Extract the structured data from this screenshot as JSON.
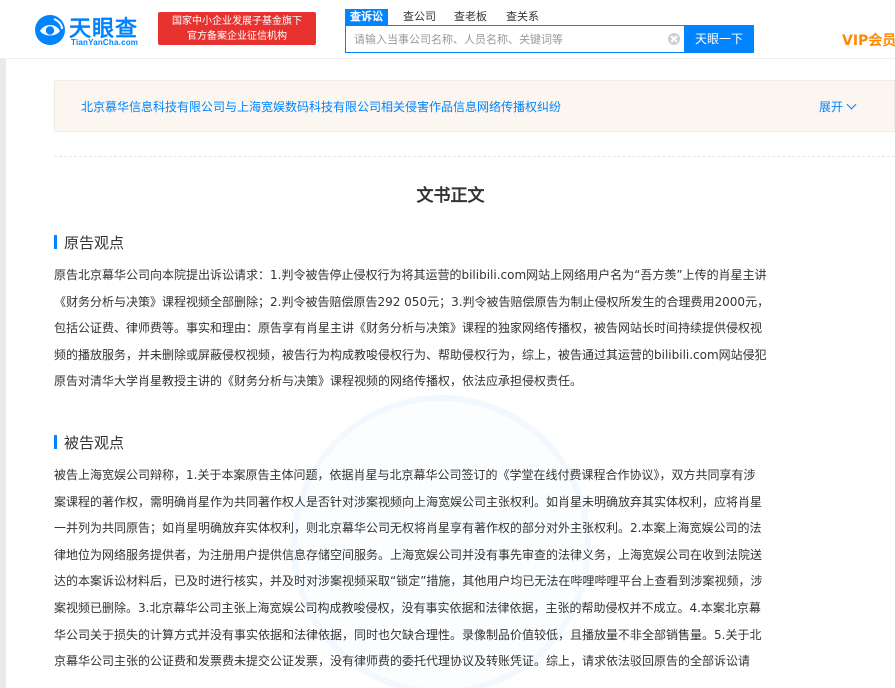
{
  "header": {
    "logo_title": "天眼查",
    "logo_sub": "TianYanCha.com",
    "badge_line1": "国家中小企业发展子基金旗下",
    "badge_line2": "官方备案企业征信机构",
    "tabs": [
      "查诉讼",
      "查公司",
      "查老板",
      "查关系"
    ],
    "search_placeholder": "请输入当事公司名称、人员名称、关键词等",
    "search_button": "天眼一下",
    "vip_label": "VIP会员"
  },
  "case": {
    "title": "北京慕华信息科技有限公司与上海宽娱数码科技有限公司相关侵害作品信息网络传播权纠纷",
    "expand_label": "展开"
  },
  "document": {
    "heading": "文书正文",
    "plaintiff": {
      "title": "原告观点",
      "lines": [
        "原告北京幕华公司向本院提出诉讼请求：1.判令被告停止侵权行为将其运营的bilibili.com网站上网络用户名为“吾方羡”上传的肖星主讲",
        "《财务分析与决策》课程视频全部删除；2.判令被告赔偿原告292 050元；3.判令被告赔偿原告为制止侵权所发生的合理费用2000元，",
        "包括公证费、律师费等。事实和理由：原告享有肖星主讲《财务分析与决策》课程的独家网络传播权，被告网站长时间持续提供侵权视",
        "频的播放服务，并未删除或屏蔽侵权视频，被告行为构成教唆侵权行为、帮助侵权行为，综上，被告通过其运营的bilibili.com网站侵犯",
        "原告对清华大学肖星教授主讲的《财务分析与决策》课程视频的网络传播权，依法应承担侵权责任。"
      ]
    },
    "defendant": {
      "title": "被告观点",
      "lines": [
        "被告上海宽娱公司辩称，1.关于本案原告主体问题，依据肖星与北京幕华公司签订的《学堂在线付费课程合作协议》，双方共同享有涉",
        "案课程的著作权，需明确肖星作为共同著作权人是否针对涉案视频向上海宽娱公司主张权利。如肖星未明确放弃其实体权利，应将肖星",
        "一并列为共同原告；如肖星明确放弃实体权利，则北京幕华公司无权将肖星享有著作权的部分对外主张权利。2.本案上海宽娱公司的法",
        "律地位为网络服务提供者，为注册用户提供信息存储空间服务。上海宽娱公司并没有事先审查的法律义务，上海宽娱公司在收到法院送",
        "达的本案诉讼材料后，已及时进行核实，并及时对涉案视频采取“锁定”措施，其他用户均已无法在哔哩哔哩平台上查看到涉案视频，涉",
        "案视频已删除。3.北京幕华公司主张上海宽娱公司构成教唆侵权，没有事实依据和法律依据，主张的帮助侵权并不成立。4.本案北京幕",
        "华公司关于损失的计算方式并没有事实依据和法律依据，同时也欠缺合理性。录像制品价值较低，且播放量不非全部销售量。5.关于北",
        "京幕华公司主张的公证费和发票费未提交公证发票，没有律师费的委托代理协议及转账凭证。综上，请求依法驳回原告的全部诉讼请"
      ]
    }
  }
}
